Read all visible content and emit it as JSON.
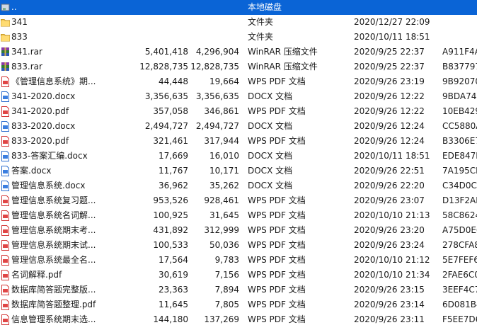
{
  "file_list": {
    "rows": [
      {
        "name": "..",
        "size": "",
        "packed": "",
        "type": "本地磁盘",
        "modified": "",
        "crc": "",
        "icon": "drive-icon",
        "selected": true
      },
      {
        "name": "341",
        "size": "",
        "packed": "",
        "type": "文件夹",
        "modified": "2020/12/27 22:09",
        "crc": "",
        "icon": "folder-icon"
      },
      {
        "name": "833",
        "size": "",
        "packed": "",
        "type": "文件夹",
        "modified": "2020/10/11 18:51",
        "crc": "",
        "icon": "folder-icon"
      },
      {
        "name": "341.rar",
        "size": "5,401,418",
        "packed": "4,296,904",
        "type": "WinRAR 压缩文件",
        "modified": "2020/9/25 22:37",
        "crc": "A911F4A",
        "icon": "rar-archive-icon"
      },
      {
        "name": "833.rar",
        "size": "12,828,735",
        "packed": "12,828,735",
        "type": "WinRAR 压缩文件",
        "modified": "2020/9/25 22:37",
        "crc": "B837797",
        "icon": "rar-archive-icon"
      },
      {
        "name": "《管理信息系统》期...",
        "size": "44,448",
        "packed": "19,664",
        "type": "WPS PDF 文档",
        "modified": "2020/9/26 23:19",
        "crc": "9B92070",
        "icon": "pdf-icon"
      },
      {
        "name": "341-2020.docx",
        "size": "3,356,635",
        "packed": "3,356,635",
        "type": "DOCX 文档",
        "modified": "2020/9/26 12:22",
        "crc": "9BDA746",
        "icon": "docx-icon"
      },
      {
        "name": "341-2020.pdf",
        "size": "357,058",
        "packed": "346,861",
        "type": "WPS PDF 文档",
        "modified": "2020/9/26 12:22",
        "crc": "10EB429",
        "icon": "pdf-icon"
      },
      {
        "name": "833-2020.docx",
        "size": "2,494,727",
        "packed": "2,494,727",
        "type": "DOCX 文档",
        "modified": "2020/9/26 12:24",
        "crc": "CC5880A",
        "icon": "docx-icon"
      },
      {
        "name": "833-2020.pdf",
        "size": "321,461",
        "packed": "317,944",
        "type": "WPS PDF 文档",
        "modified": "2020/9/26 12:24",
        "crc": "B3306E7",
        "icon": "pdf-icon"
      },
      {
        "name": "833-答案汇编.docx",
        "size": "17,669",
        "packed": "16,010",
        "type": "DOCX 文档",
        "modified": "2020/10/11 18:51",
        "crc": "EDE847F",
        "icon": "docx-icon"
      },
      {
        "name": "答案.docx",
        "size": "11,767",
        "packed": "10,171",
        "type": "DOCX 文档",
        "modified": "2020/9/26 22:51",
        "crc": "7A195CD",
        "icon": "docx-icon"
      },
      {
        "name": "管理信息系统.docx",
        "size": "36,962",
        "packed": "35,262",
        "type": "DOCX 文档",
        "modified": "2020/9/26 22:20",
        "crc": "C34D0CA",
        "icon": "docx-icon"
      },
      {
        "name": "管理信息系统复习题...",
        "size": "953,526",
        "packed": "928,461",
        "type": "WPS PDF 文档",
        "modified": "2020/9/26 23:07",
        "crc": "D13F2AE",
        "icon": "pdf-icon"
      },
      {
        "name": "管理信息系统名词解...",
        "size": "100,925",
        "packed": "31,645",
        "type": "WPS PDF 文档",
        "modified": "2020/10/10 21:13",
        "crc": "58C8624",
        "icon": "pdf-icon"
      },
      {
        "name": "管理信息系统期末考...",
        "size": "431,892",
        "packed": "312,999",
        "type": "WPS PDF 文档",
        "modified": "2020/9/26 23:20",
        "crc": "A75D0E6",
        "icon": "pdf-icon"
      },
      {
        "name": "管理信息系统期末试...",
        "size": "100,533",
        "packed": "50,036",
        "type": "WPS PDF 文档",
        "modified": "2020/9/26 23:24",
        "crc": "278CFA8",
        "icon": "pdf-icon"
      },
      {
        "name": "管理信息系统最全名...",
        "size": "17,564",
        "packed": "9,783",
        "type": "WPS PDF 文档",
        "modified": "2020/10/10 21:12",
        "crc": "5E7FEF6",
        "icon": "pdf-icon"
      },
      {
        "name": "名词解释.pdf",
        "size": "30,619",
        "packed": "7,156",
        "type": "WPS PDF 文档",
        "modified": "2020/10/10 21:34",
        "crc": "2FAE6C0",
        "icon": "pdf-icon"
      },
      {
        "name": "数据库简答题完整版...",
        "size": "23,363",
        "packed": "7,894",
        "type": "WPS PDF 文档",
        "modified": "2020/9/26 23:15",
        "crc": "3EEF4C7",
        "icon": "pdf-icon"
      },
      {
        "name": "数据库简答题整理.pdf",
        "size": "11,645",
        "packed": "7,805",
        "type": "WPS PDF 文档",
        "modified": "2020/9/26 23:14",
        "crc": "6D081B4",
        "icon": "pdf-icon"
      },
      {
        "name": "信息管理系统期末选...",
        "size": "144,180",
        "packed": "137,269",
        "type": "WPS PDF 文档",
        "modified": "2020/9/26 23:11",
        "crc": "F5EE7D6",
        "icon": "pdf-icon"
      }
    ]
  }
}
